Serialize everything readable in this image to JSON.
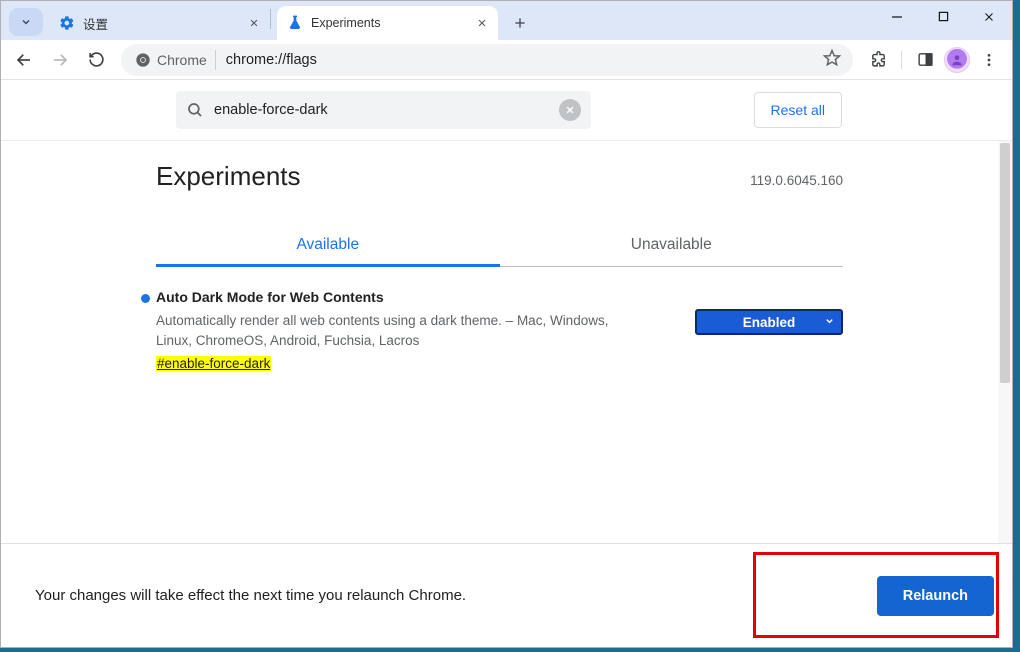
{
  "tabs": [
    {
      "label": "设置",
      "icon": "gear"
    },
    {
      "label": "Experiments",
      "icon": "flask"
    }
  ],
  "omnibox": {
    "source_label": "Chrome",
    "url": "chrome://flags"
  },
  "search": {
    "value": "enable-force-dark",
    "reset_label": "Reset all"
  },
  "page": {
    "title": "Experiments",
    "version": "119.0.6045.160"
  },
  "content_tabs": {
    "available": "Available",
    "unavailable": "Unavailable"
  },
  "flag": {
    "title": "Auto Dark Mode for Web Contents",
    "description": "Automatically render all web contents using a dark theme. – Mac, Windows, Linux, ChromeOS, Android, Fuchsia, Lacros",
    "anchor": "#enable-force-dark",
    "value": "Enabled"
  },
  "bottom": {
    "message": "Your changes will take effect the next time you relaunch Chrome.",
    "relaunch": "Relaunch"
  }
}
